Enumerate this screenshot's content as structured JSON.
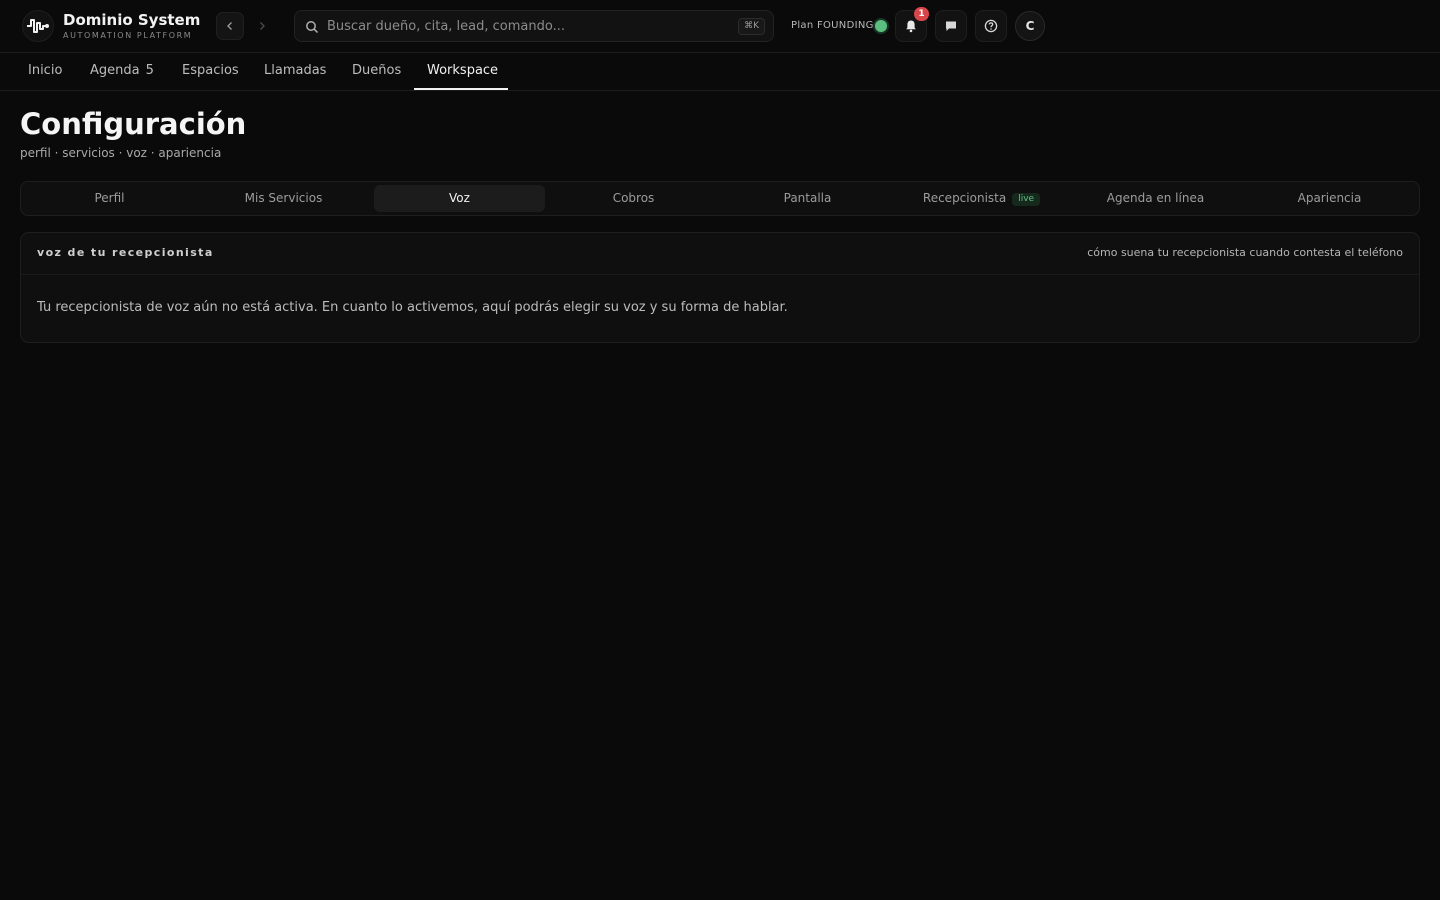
{
  "brand": {
    "name": "Dominio System",
    "tagline": "AUTOMATION PLATFORM"
  },
  "search": {
    "placeholder": "Buscar dueño, cita, lead, comando...",
    "shortcut": "⌘K"
  },
  "plan": {
    "label": "Plan FOUNDING",
    "status_color": "#5cbf80"
  },
  "notifications": {
    "count": "1"
  },
  "user": {
    "initial": "C"
  },
  "main_nav": {
    "items": [
      {
        "label": "Inicio"
      },
      {
        "label": "Agenda",
        "count": "5"
      },
      {
        "label": "Espacios"
      },
      {
        "label": "Llamadas"
      },
      {
        "label": "Dueños"
      },
      {
        "label": "Workspace",
        "active": true
      }
    ]
  },
  "page": {
    "title": "Configuración",
    "subtitle": "perfil · servicios · voz · apariencia"
  },
  "tabs": [
    {
      "label": "Perfil"
    },
    {
      "label": "Mis Servicios"
    },
    {
      "label": "Voz",
      "active": true
    },
    {
      "label": "Cobros"
    },
    {
      "label": "Pantalla"
    },
    {
      "label": "Recepcionista",
      "badge": "live"
    },
    {
      "label": "Agenda en línea"
    },
    {
      "label": "Apariencia"
    }
  ],
  "panel": {
    "title": "voz de tu recepcionista",
    "hint": "cómo suena tu recepcionista cuando contesta el teléfono",
    "body": "Tu recepcionista de voz aún no está activa. En cuanto lo activemos, aquí podrás elegir su voz y su forma de hablar."
  },
  "colors": {
    "background": "#0a0a0a",
    "badge_red": "#d9464a",
    "live_green": "#5fc27f"
  }
}
